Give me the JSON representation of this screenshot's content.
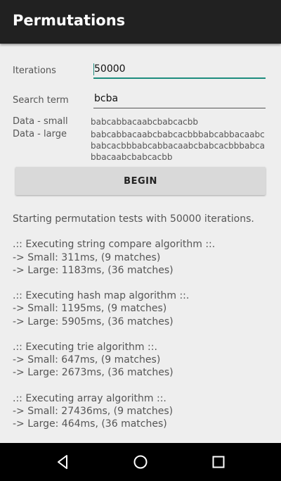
{
  "appbar": {
    "title": "Permutations"
  },
  "form": {
    "iterations_label": "Iterations",
    "iterations_value": "50000",
    "search_label": "Search term",
    "search_value": "bcba",
    "small_label": "Data - small",
    "small_value": "babcabbacaabcbabcacbb",
    "large_label": "Data - large",
    "large_value": "babcabbacaabcbabcacbbbabcabbacaabcbabcacbbbabcabbacaabcbabcacbbbabcabbacaabcbabcacbb"
  },
  "button": {
    "label": "BEGIN"
  },
  "output": {
    "intro": "Starting permutation tests with 50000 iterations.",
    "blocks": [
      {
        "header": ".:: Executing string compare algorithm ::.",
        "small": "-> Small: 311ms, (9 matches)",
        "large": "-> Large: 1183ms, (36 matches)"
      },
      {
        "header": ".:: Executing hash map algorithm ::.",
        "small": "-> Small: 1195ms, (9 matches)",
        "large": "-> Large: 5905ms, (36 matches)"
      },
      {
        "header": ".:: Executing trie algorithm ::.",
        "small": "-> Small: 647ms, (9 matches)",
        "large": "-> Large: 2673ms, (36 matches)"
      },
      {
        "header": ".:: Executing array algorithm ::.",
        "small": "-> Small: 27436ms, (9 matches)",
        "large": "-> Large: 464ms, (36 matches)"
      }
    ]
  },
  "navbar": {
    "icons": [
      "back-icon",
      "home-icon",
      "recents-icon"
    ]
  },
  "colors": {
    "accent": "#1e8c7e",
    "appbar": "#212121",
    "background": "#eeeeee"
  }
}
